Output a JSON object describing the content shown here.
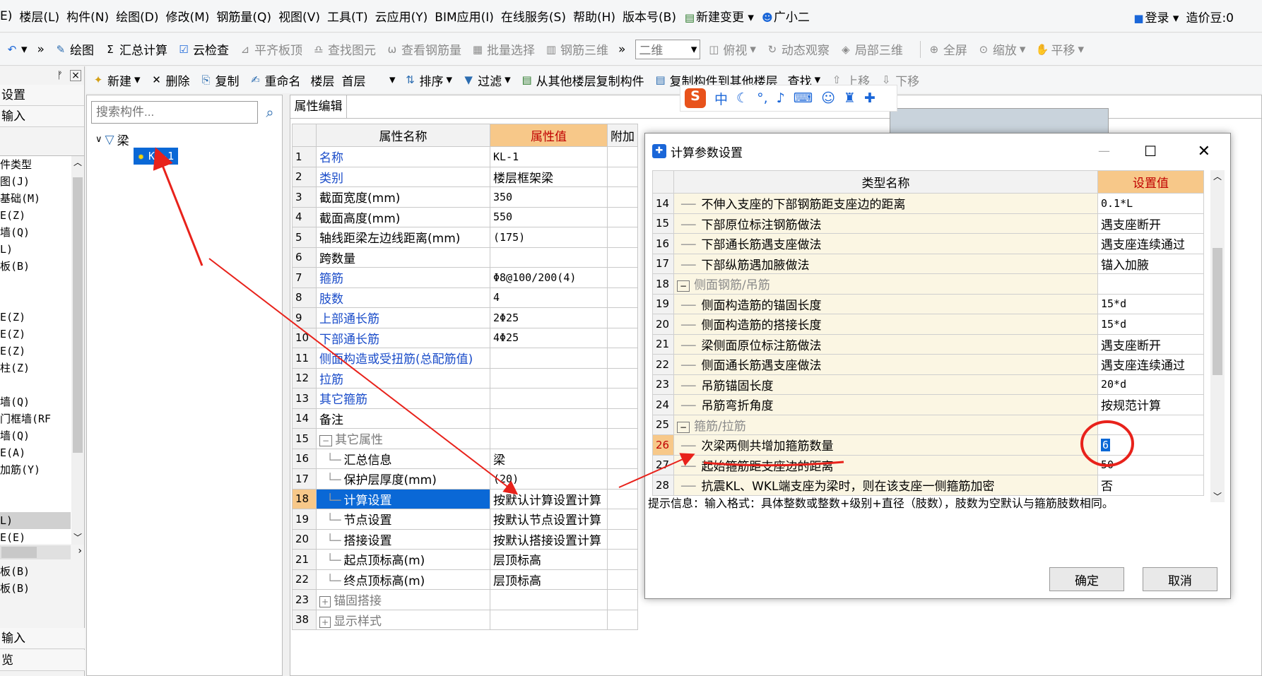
{
  "menu": {
    "items": [
      "E)",
      "楼层(L)",
      "构件(N)",
      "绘图(D)",
      "修改(M)",
      "钢筋量(Q)",
      "视图(V)",
      "工具(T)",
      "云应用(Y)",
      "BIM应用(I)",
      "在线服务(S)",
      "帮助(H)",
      "版本号(B)"
    ],
    "new_change": "新建变更",
    "assistant": "广小二",
    "login": "登录",
    "price_bean": "造价豆:0"
  },
  "toolbar1": {
    "draw": "绘图",
    "summary": "汇总计算",
    "cloud_check": "云检查",
    "flush_top": "平齐板顶",
    "find_element": "查找图元",
    "view_rebar": "查看钢筋量",
    "batch_select": "批量选择",
    "rebar_3d": "钢筋三维",
    "view_mode": "二维",
    "top_view": "俯视",
    "dynamic": "动态观察",
    "local_3d": "局部三维",
    "fullscreen": "全屏",
    "zoom": "缩放",
    "pan": "平移"
  },
  "toolbar2": {
    "new": "新建",
    "delete": "删除",
    "copy": "复制",
    "rename": "重命名",
    "floor_label": "楼层",
    "floor_value": "首层",
    "sort": "排序",
    "filter": "过滤",
    "copy_from": "从其他楼层复制构件",
    "copy_to": "复制构件到其他楼层",
    "find": "查找",
    "move_up": "上移",
    "move_down": "下移"
  },
  "left_panel": {
    "settings": "设置",
    "input": "输入",
    "items": [
      "件类型",
      "图(J)",
      "基础(M)",
      "E(Z)",
      "墙(Q)",
      "L)",
      "板(B)",
      "",
      "",
      "E(Z)",
      "E(Z)",
      "E(Z)",
      "柱(Z)",
      "",
      "墙(Q)",
      "门框墙(RF",
      "墙(Q)",
      "E(A)",
      "加筋(Y)",
      "",
      "",
      "L)",
      "E(E)",
      "",
      "板(B)",
      "板(B)"
    ],
    "bottom1": "输入",
    "bottom2": "览"
  },
  "tree": {
    "search_placeholder": "搜索构件...",
    "root": "梁",
    "child": "KL-1"
  },
  "property_grid": {
    "tab": "属性编辑",
    "headers": [
      "属性名称",
      "属性值",
      "附加"
    ],
    "rows": [
      {
        "num": "1",
        "name": "名称",
        "value": "KL-1",
        "blue": true
      },
      {
        "num": "2",
        "name": "类别",
        "value": "楼层框架梁",
        "blue": true
      },
      {
        "num": "3",
        "name": "截面宽度(mm)",
        "value": "350"
      },
      {
        "num": "4",
        "name": "截面高度(mm)",
        "value": "550"
      },
      {
        "num": "5",
        "name": "轴线距梁左边线距离(mm)",
        "value": "(175)"
      },
      {
        "num": "6",
        "name": "跨数量",
        "value": ""
      },
      {
        "num": "7",
        "name": "箍筋",
        "value": "Φ8@100/200(4)",
        "blue": true
      },
      {
        "num": "8",
        "name": "肢数",
        "value": "4",
        "blue": true
      },
      {
        "num": "9",
        "name": "上部通长筋",
        "value": "2Φ25",
        "blue": true
      },
      {
        "num": "10",
        "name": "下部通长筋",
        "value": "4Φ25",
        "blue": true
      },
      {
        "num": "11",
        "name": "侧面构造或受扭筋(总配筋值)",
        "value": "",
        "blue": true
      },
      {
        "num": "12",
        "name": "拉筋",
        "value": "",
        "blue": true
      },
      {
        "num": "13",
        "name": "其它箍筋",
        "value": "",
        "blue": true
      },
      {
        "num": "14",
        "name": "备注",
        "value": ""
      },
      {
        "num": "15",
        "name": "其它属性",
        "value": "",
        "group": true
      },
      {
        "num": "16",
        "name": "汇总信息",
        "value": "梁",
        "child": true
      },
      {
        "num": "17",
        "name": "保护层厚度(mm)",
        "value": "(20)",
        "child": true
      },
      {
        "num": "18",
        "name": "计算设置",
        "value": "按默认计算设置计算",
        "child": true,
        "selected": true
      },
      {
        "num": "19",
        "name": "节点设置",
        "value": "按默认节点设置计算",
        "child": true
      },
      {
        "num": "20",
        "name": "搭接设置",
        "value": "按默认搭接设置计算",
        "child": true
      },
      {
        "num": "21",
        "name": "起点顶标高(m)",
        "value": "层顶标高",
        "child": true
      },
      {
        "num": "22",
        "name": "终点顶标高(m)",
        "value": "层顶标高",
        "child": true
      },
      {
        "num": "23",
        "name": "锚固搭接",
        "value": "",
        "group": true,
        "plus": true
      },
      {
        "num": "38",
        "name": "显示样式",
        "value": "",
        "group": true,
        "plus": true
      }
    ]
  },
  "dialog": {
    "title": "计算参数设置",
    "headers": [
      "类型名称",
      "设置值"
    ],
    "rows": [
      {
        "num": "14",
        "name": "不伸入支座的下部钢筋距支座边的距离",
        "value": "0.1*L"
      },
      {
        "num": "15",
        "name": "下部原位标注钢筋做法",
        "value": "遇支座断开"
      },
      {
        "num": "16",
        "name": "下部通长筋遇支座做法",
        "value": "遇支座连续通过"
      },
      {
        "num": "17",
        "name": "下部纵筋遇加腋做法",
        "value": "锚入加腋"
      },
      {
        "num": "18",
        "name": "侧面钢筋/吊筋",
        "value": "",
        "cat": true
      },
      {
        "num": "19",
        "name": "侧面构造筋的锚固长度",
        "value": "15*d"
      },
      {
        "num": "20",
        "name": "侧面构造筋的搭接长度",
        "value": "15*d"
      },
      {
        "num": "21",
        "name": "梁侧面原位标注筋做法",
        "value": "遇支座断开"
      },
      {
        "num": "22",
        "name": "侧面通长筋遇支座做法",
        "value": "遇支座连续通过"
      },
      {
        "num": "23",
        "name": "吊筋锚固长度",
        "value": "20*d"
      },
      {
        "num": "24",
        "name": "吊筋弯折角度",
        "value": "按规范计算"
      },
      {
        "num": "25",
        "name": "箍筋/拉筋",
        "value": "",
        "cat": true
      },
      {
        "num": "26",
        "name": "次梁两侧共增加箍筋数量",
        "value": "6",
        "current": true
      },
      {
        "num": "27",
        "name": "起始箍筋距支座边的距离",
        "value": "50"
      },
      {
        "num": "28",
        "name": "抗震KL、WKL端支座为梁时，则在该支座一侧箍筋加密",
        "value": "否"
      }
    ],
    "hint": "提示信息：输入格式：具体整数或整数+级别+直径（肢数），肢数为空默认与箍筋肢数相同。",
    "ok": "确定",
    "cancel": "取消"
  },
  "colors": {
    "accent_blue": "#0a68d6",
    "header_orange": "#f7c889",
    "annotation_red": "#e8221b"
  }
}
